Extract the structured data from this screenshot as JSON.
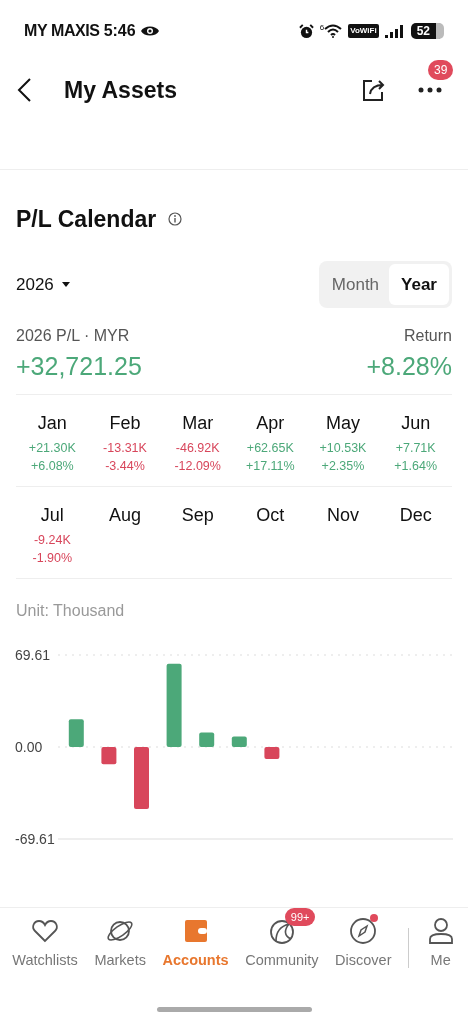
{
  "status_bar": {
    "carrier": "MY MAXIS",
    "time": "5:46",
    "network_gen": "6",
    "wifi_calling": "VoWiFi",
    "battery": "52"
  },
  "header": {
    "title": "My Assets",
    "more_badge": "39"
  },
  "calendar": {
    "title": "P/L Calendar",
    "year": "2026",
    "view_tabs": [
      {
        "label": "Month",
        "selected": false
      },
      {
        "label": "Year",
        "selected": true
      }
    ],
    "pl_label": "2026 P/L · MYR",
    "pl_value": "+32,721.25",
    "return_label": "Return",
    "return_value": "+8.28%",
    "months": [
      {
        "month": "Jan",
        "pl": "+21.30K",
        "return": "+6.08%",
        "color": "#4ca879"
      },
      {
        "month": "Feb",
        "pl": "-13.31K",
        "return": "-3.44%",
        "color": "#d8465b"
      },
      {
        "month": "Mar",
        "pl": "-46.92K",
        "return": "-12.09%",
        "color": "#d8465b"
      },
      {
        "month": "Apr",
        "pl": "+62.65K",
        "return": "+17.11%",
        "color": "#4ca879"
      },
      {
        "month": "May",
        "pl": "+10.53K",
        "return": "+2.35%",
        "color": "#4ca879"
      },
      {
        "month": "Jun",
        "pl": "+7.71K",
        "return": "+1.64%",
        "color": "#4ca879"
      },
      {
        "month": "Jul",
        "pl": "-9.24K",
        "return": "-1.90%",
        "color": "#d8465b"
      },
      {
        "month": "Aug"
      },
      {
        "month": "Sep"
      },
      {
        "month": "Oct"
      },
      {
        "month": "Nov"
      },
      {
        "month": "Dec"
      }
    ],
    "unit": "Unit: Thousand",
    "chart_data": {
      "type": "bar",
      "values": [
        21,
        -13,
        -47,
        63,
        11,
        8,
        -9,
        null,
        null,
        null,
        null,
        null
      ],
      "ylim": [
        -69.61,
        69.61
      ],
      "yticks": [
        {
          "value": 69.61,
          "label": "69.61"
        },
        {
          "value": 0,
          "label": "0.00"
        },
        {
          "value": -69.61,
          "label": "-69.61"
        }
      ]
    }
  },
  "tab_bar": [
    {
      "label": "Watchlists",
      "selected": false
    },
    {
      "label": "Markets",
      "selected": false
    },
    {
      "label": "Accounts",
      "selected": true
    },
    {
      "label": "Community",
      "selected": false,
      "badge": "99+"
    },
    {
      "label": "Discover",
      "selected": false,
      "dot": true
    },
    {
      "label": "Me",
      "selected": false
    }
  ]
}
